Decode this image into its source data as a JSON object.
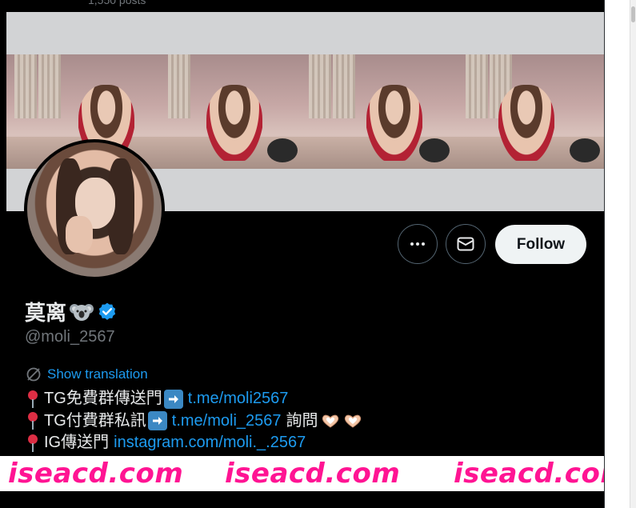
{
  "header": {
    "posts_count": "1,550 posts"
  },
  "profile": {
    "display_name": "莫离",
    "name_emoji": "koala-emoji",
    "verified": "verified-badge-icon",
    "handle": "@moli_2567"
  },
  "actions": {
    "more_label": "More",
    "message_label": "Message",
    "follow_label": "Follow"
  },
  "translate": {
    "label": "Show translation"
  },
  "bio": {
    "lines": [
      {
        "text": "TG免費群傳送門",
        "link": "t.me/moli2567",
        "suffix": ""
      },
      {
        "text": "TG付費群私訊",
        "link": "t.me/moli_2567",
        "suffix": "詢問"
      },
      {
        "text": "IG傳送門",
        "link": "instagram.com/moli._.2567",
        "suffix": ""
      }
    ]
  },
  "watermark": {
    "text_1": "iseacd.com",
    "text_2": "iseacd.com",
    "text_3": "iseacd.com"
  },
  "colors": {
    "accent": "#1d9bf0",
    "follow_bg": "#eff3f4",
    "watermark": "#ff1493",
    "background": "#000000"
  }
}
